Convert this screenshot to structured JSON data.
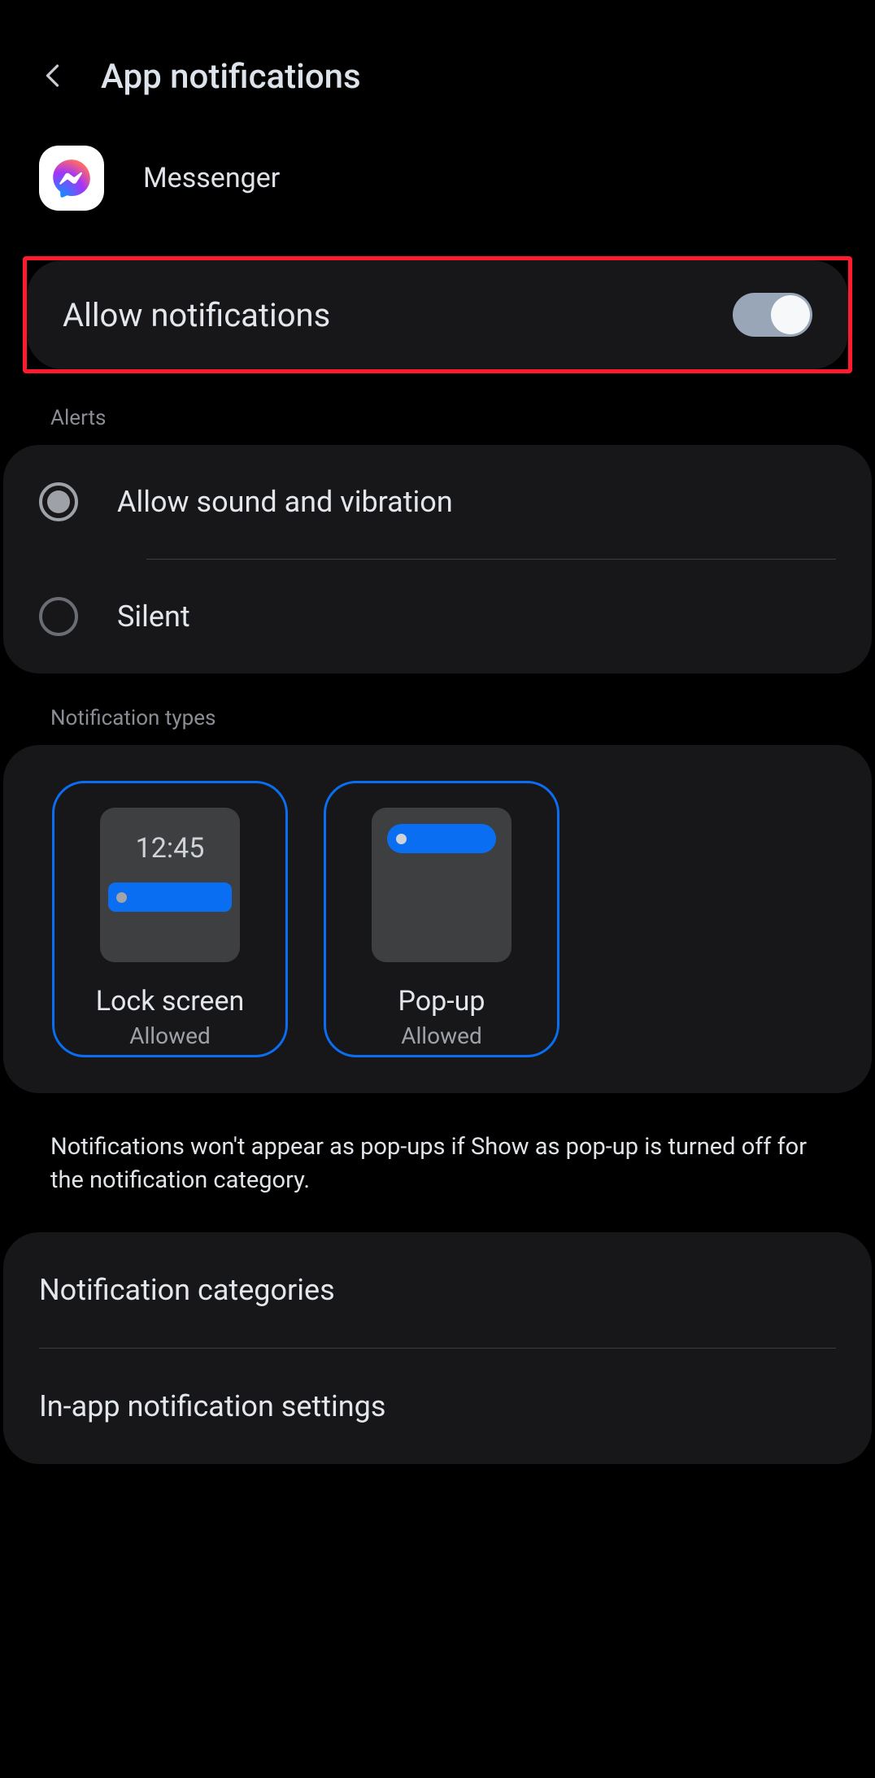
{
  "header": {
    "title": "App notifications"
  },
  "app": {
    "name": "Messenger"
  },
  "allow_notifications": {
    "label": "Allow notifications",
    "enabled": true
  },
  "sections": {
    "alerts_label": "Alerts",
    "types_label": "Notification types"
  },
  "alerts": {
    "options": [
      {
        "label": "Allow sound and vibration",
        "selected": true
      },
      {
        "label": "Silent",
        "selected": false
      }
    ]
  },
  "notification_types": {
    "lock_screen": {
      "title": "Lock screen",
      "status": "Allowed",
      "illus_time": "12:45"
    },
    "popup": {
      "title": "Pop-up",
      "status": "Allowed"
    }
  },
  "note": "Notifications won't appear as pop-ups if Show as pop-up is turned off for the notification category.",
  "links": {
    "categories": "Notification categories",
    "in_app": "In-app notification settings"
  }
}
